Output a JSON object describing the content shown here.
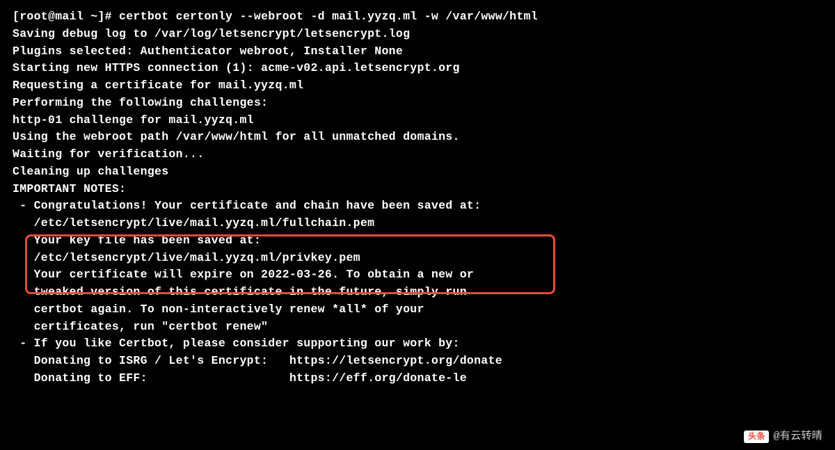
{
  "terminal": {
    "prompt": "[root@mail ~]# ",
    "command": "certbot certonly --webroot -d mail.yyzq.ml -w /var/www/html",
    "lines": {
      "l0": "Saving debug log to /var/log/letsencrypt/letsencrypt.log",
      "l1": "Plugins selected: Authenticator webroot, Installer None",
      "l2": "Starting new HTTPS connection (1): acme-v02.api.letsencrypt.org",
      "l3": "Requesting a certificate for mail.yyzq.ml",
      "l4": "Performing the following challenges:",
      "l5": "http-01 challenge for mail.yyzq.ml",
      "l6": "Using the webroot path /var/www/html for all unmatched domains.",
      "l7": "Waiting for verification...",
      "l8": "Cleaning up challenges",
      "l9": "",
      "l10": "IMPORTANT NOTES:",
      "l11": " - Congratulations! Your certificate and chain have been saved at:",
      "l12": "   /etc/letsencrypt/live/mail.yyzq.ml/fullchain.pem",
      "l13": "   Your key file has been saved at:",
      "l14": "   /etc/letsencrypt/live/mail.yyzq.ml/privkey.pem",
      "l15": "   Your certificate will expire on 2022-03-26. To obtain a new or",
      "l16": "   tweaked version of this certificate in the future, simply run",
      "l17": "   certbot again. To non-interactively renew *all* of your",
      "l18": "   certificates, run \"certbot renew\"",
      "l19": " - If you like Certbot, please consider supporting our work by:",
      "l20": "",
      "l21": "   Donating to ISRG / Let's Encrypt:   https://letsencrypt.org/donate",
      "l22": "   Donating to EFF:                    https://eff.org/donate-le"
    }
  },
  "watermark": {
    "logo_text": "头条",
    "author": "@有云转晴"
  }
}
